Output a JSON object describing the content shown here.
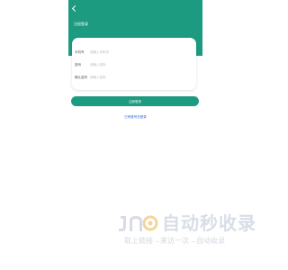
{
  "header": {
    "title": "注册登录",
    "back_icon": "chevron-left-icon"
  },
  "form": {
    "fields": [
      {
        "label": "手机号",
        "placeholder": "请输入手机号",
        "value": ""
      },
      {
        "label": "密码",
        "placeholder": "请输入密码",
        "value": ""
      },
      {
        "label": "确认密码",
        "placeholder": "请输入密码",
        "value": ""
      }
    ],
    "submit_label": "注册登录"
  },
  "login_link": "已有账号去登录",
  "watermark": {
    "title": "自动秒收录",
    "subtitle": "取上链接→来访一次→自动收录"
  },
  "colors": {
    "brand": "#1c9b80",
    "link": "#2a5fd8",
    "watermark": "#d9dde8"
  }
}
